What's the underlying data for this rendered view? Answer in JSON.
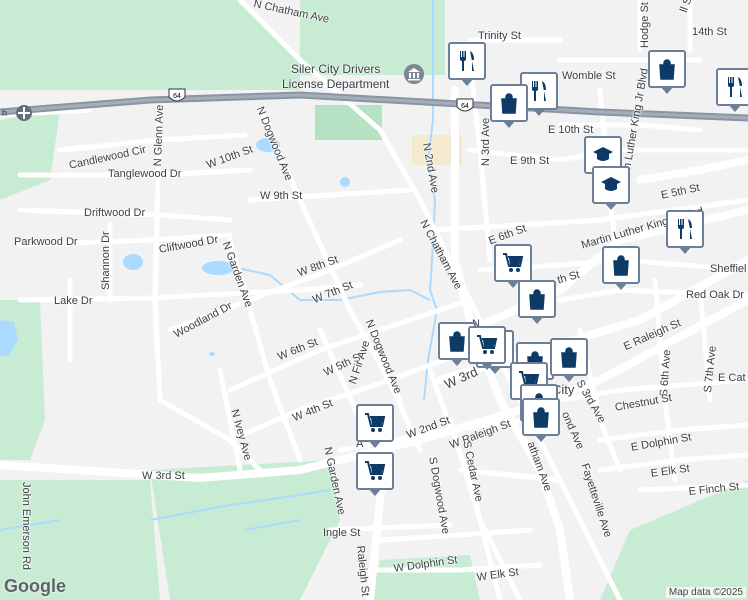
{
  "poi": {
    "title_line1": "Siler City Drivers",
    "title_line2": "License Department"
  },
  "town_label": "City",
  "attribution": {
    "google": "Google",
    "map_data": "Map data ©2025"
  },
  "shields": {
    "us64": "64"
  },
  "streets": {
    "n_chatham_ave_top": "N Chatham Ave",
    "trinity_st": "Trinity St",
    "fourteenth_st": "14th St",
    "hodge_st": "Hodge St",
    "ll_st": "ll St",
    "womble_st": "Womble St",
    "e_10th_st": "E 10th St",
    "e_9th_st": "E 9th St",
    "n_3rd_ave": "N 3rd Ave",
    "n_2nd_ave": "N 2nd Ave",
    "n_dogwood_ave_top": "N Dogwood Ave",
    "n_glenn_ave": "N Glenn Ave",
    "candlewood_cir": "Candlewood Cir",
    "w_10th_st": "W 10th St",
    "tanglewood_dr": "Tanglewood Dr",
    "w_9th_st": "W 9th St",
    "driftwood_dr": "Driftwood Dr",
    "parkwood_dr": "Parkwood Dr",
    "shannon_dr": "Shannon Dr",
    "cliftwood_dr": "Cliftwood Dr",
    "n_garden_ave_mid": "N Garden Ave",
    "w_8th_st": "W 8th St",
    "w_7th_st": "W 7th St",
    "lake_dr": "Lake Dr",
    "woodland_dr": "Woodland Dr",
    "n_chatham_ave_mid": "N Chatham Ave",
    "e_6th_st": "E 6th St",
    "mlk_blvd_top": "Martin Luther King Jr Blvd",
    "mlk_blvd_side": "Martin Luther King Jr Blvd",
    "e_5th_st": "E 5th St",
    "sheffield": "Sheffiel",
    "th_st": "th St",
    "red_oak_dr": "Red Oak Dr",
    "w_6th_st": "W 6th St",
    "w_5th_st": "W 5th St",
    "n_dogwood_ave_mid": "N Dogwood Ave",
    "w_3rd_mid": "W 3rd",
    "e_raleigh_st": "E Raleigh St",
    "s_6th_ave": "S 6th Ave",
    "s_7th_ave": "S 7th Ave",
    "e_cat": "E Cat",
    "n_ivey_ave": "N Ivey Ave",
    "n_fir_ave": "N Fir Ave",
    "w_4th_st": "W 4th St",
    "w_2nd_st": "W 2nd St",
    "w_raleigh_st": "W Raleigh St",
    "s_3rd_ave": "S 3rd Ave",
    "chestnut_st": "Chestnut St",
    "e_dolphin_st": "E Dolphin St",
    "e_elk_st": "E Elk St",
    "e_finch_st": "E Finch St",
    "n_garden_ave_low": "N Garden Ave",
    "s_dogwood_ave": "S Dogwood Ave",
    "s_cedar_ave": "S Cedar Ave",
    "atham_ave": "atham Ave",
    "ond_ave": "ond Ave",
    "fayetteville_ave": "Fayetteville Ave",
    "w_3rd_st": "W 3rd St",
    "john_emerson_rd": "John Emerson Rd",
    "ingle_st": "Ingle St",
    "raleigh_st": "Raleigh St",
    "w_dolphin_st": "W Dolphin St",
    "w_elk_st": "W Elk St",
    "n_letter": "N",
    "a_letter": "A"
  },
  "markers": [
    {
      "type": "restaurant"
    },
    {
      "type": "restaurant"
    },
    {
      "type": "shopping"
    },
    {
      "type": "shopping"
    },
    {
      "type": "restaurant"
    },
    {
      "type": "school"
    },
    {
      "type": "school"
    },
    {
      "type": "restaurant"
    },
    {
      "type": "grocery"
    },
    {
      "type": "shopping"
    },
    {
      "type": "shopping"
    },
    {
      "type": "shopping"
    },
    {
      "type": "grocery"
    },
    {
      "type": "grocery"
    },
    {
      "type": "shopping"
    },
    {
      "type": "shopping"
    },
    {
      "type": "grocery"
    },
    {
      "type": "shopping"
    },
    {
      "type": "shopping"
    },
    {
      "type": "grocery"
    },
    {
      "type": "grocery"
    }
  ],
  "colors": {
    "park": "#c8ecd3",
    "water": "#aadaff",
    "road": "#ffffff",
    "highway": "#8a95a3",
    "marker_border": "#6b7f99",
    "marker_icon": "#0d3b66"
  }
}
